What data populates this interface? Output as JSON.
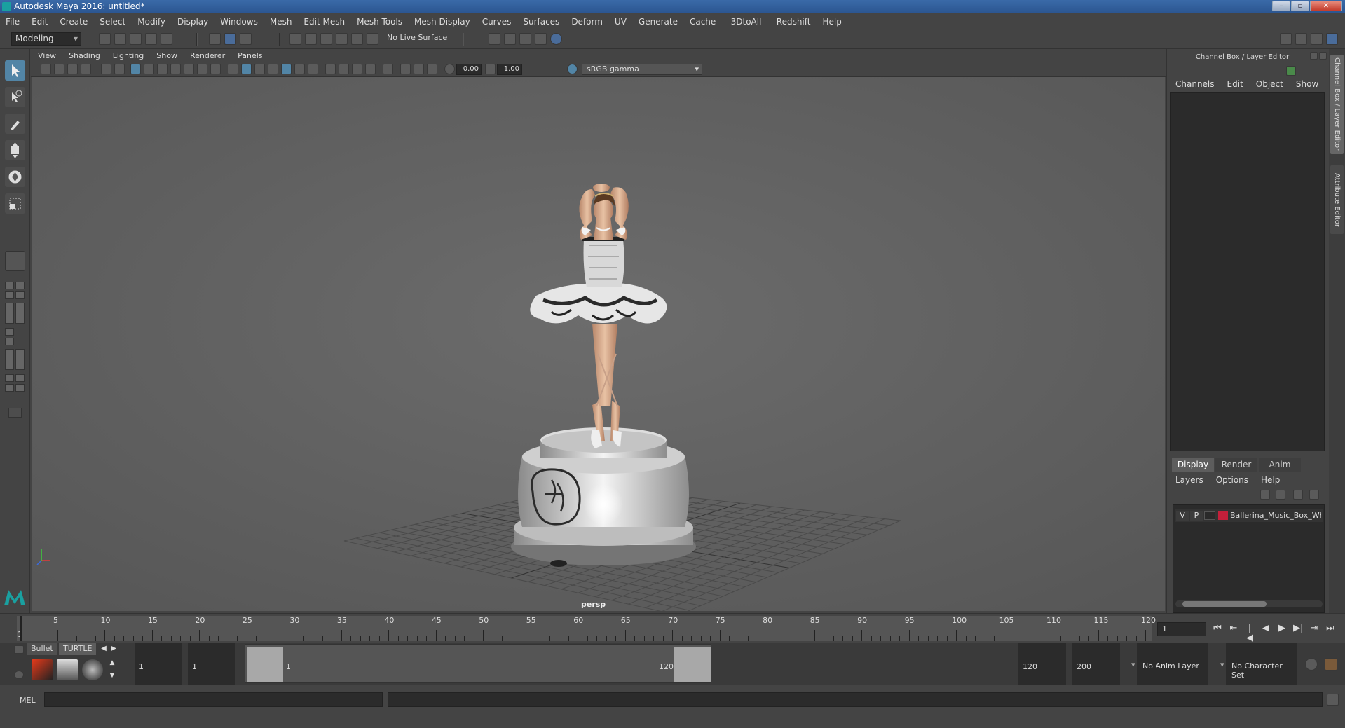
{
  "window": {
    "title": "Autodesk Maya 2016: untitled*",
    "minimize": "–",
    "restore": "▫",
    "close": "✕"
  },
  "menubar": [
    "File",
    "Edit",
    "Create",
    "Select",
    "Modify",
    "Display",
    "Windows",
    "Mesh",
    "Edit Mesh",
    "Mesh Tools",
    "Mesh Display",
    "Curves",
    "Surfaces",
    "Deform",
    "UV",
    "Generate",
    "Cache",
    "-3DtoAll-",
    "Redshift",
    "Help"
  ],
  "status_line": {
    "mode": "Modeling",
    "live_surface": "No Live Surface"
  },
  "viewport": {
    "menu": [
      "View",
      "Shading",
      "Lighting",
      "Show",
      "Renderer",
      "Panels"
    ],
    "exposure": "0.00",
    "gamma_value": "1.00",
    "color_space": "sRGB gamma",
    "camera_label": "persp"
  },
  "channel_box": {
    "title": "Channel Box / Layer Editor",
    "menu": [
      "Channels",
      "Edit",
      "Object",
      "Show"
    ]
  },
  "layer_editor": {
    "tabs": [
      "Display",
      "Render",
      "Anim"
    ],
    "active_tab": "Display",
    "menu": [
      "Layers",
      "Options",
      "Help"
    ],
    "layers": [
      {
        "visible": "V",
        "playback": "P",
        "color": "#c41f3a",
        "name": "Ballerina_Music_Box_Wh"
      }
    ]
  },
  "side_tabs": [
    "Channel Box / Layer Editor",
    "Attribute Editor"
  ],
  "timeline": {
    "start_label": "1",
    "tick_labels": [
      "5",
      "10",
      "15",
      "20",
      "25",
      "30",
      "35",
      "40",
      "45",
      "50",
      "55",
      "60",
      "65",
      "70",
      "75",
      "80",
      "85",
      "90",
      "95",
      "100",
      "105",
      "110",
      "115",
      "120"
    ],
    "current_frame": "1"
  },
  "range_slider": {
    "shelf_tabs": [
      "Bullet",
      "TURTLE"
    ],
    "start_time": "1",
    "playback_start": "1",
    "range_start_label": "1",
    "range_end_label": "120",
    "playback_end": "120",
    "end_time": "200",
    "anim_layer": "No Anim Layer",
    "character_set": "No Character Set"
  },
  "command_line": {
    "language": "MEL"
  }
}
